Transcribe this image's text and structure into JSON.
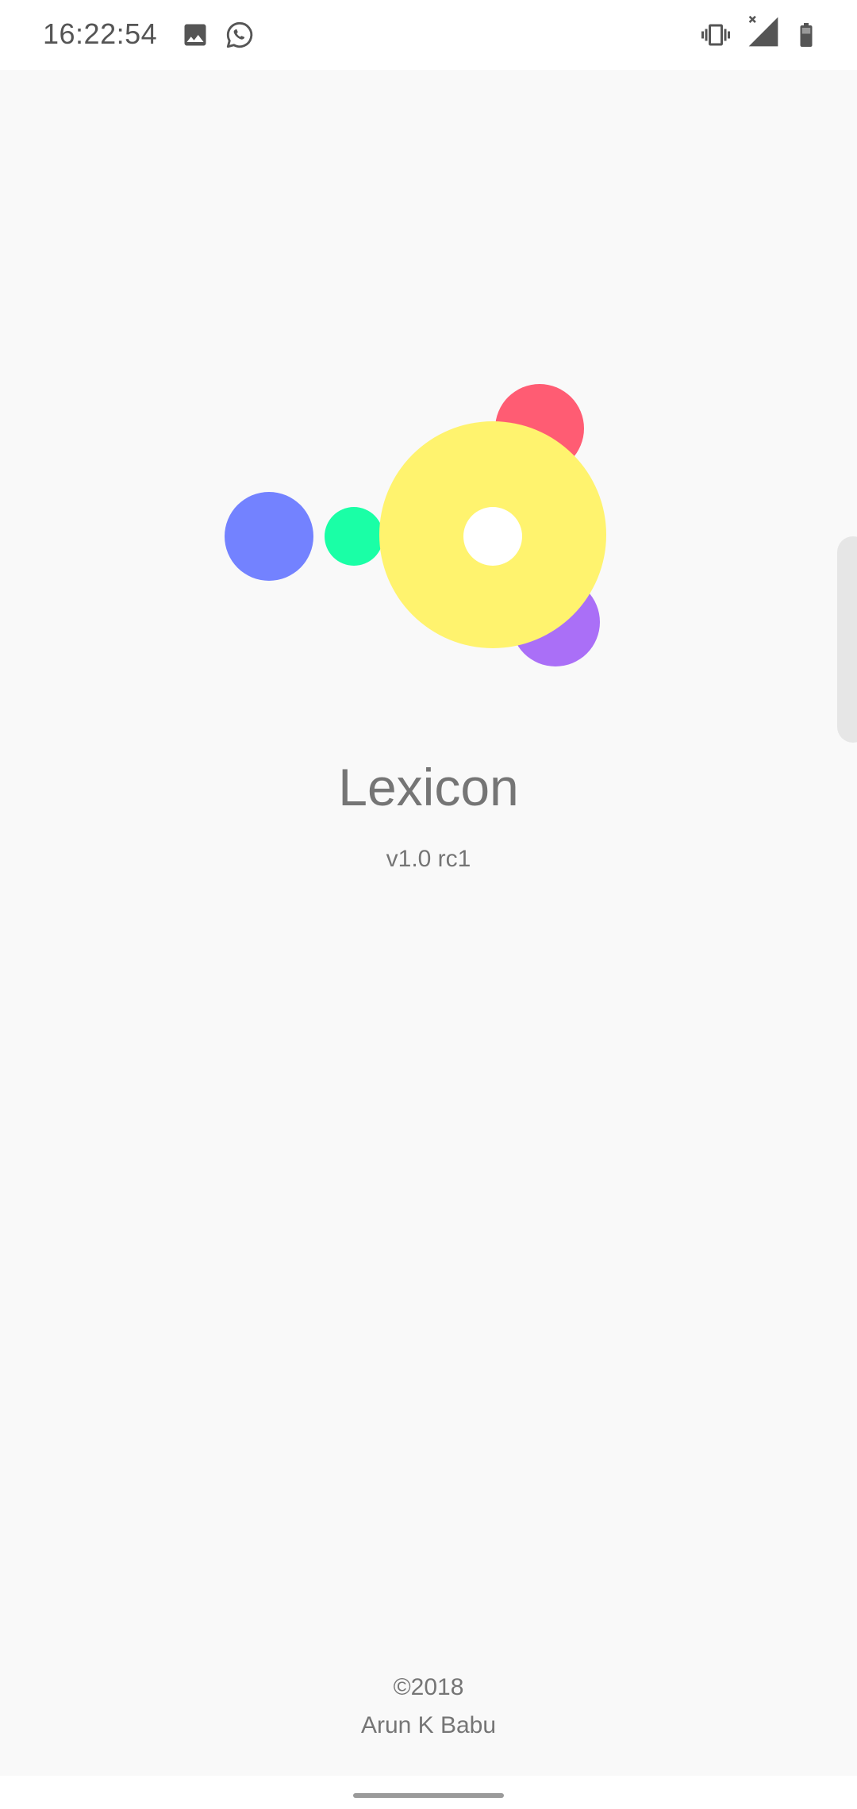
{
  "status_bar": {
    "time": "16:22:54",
    "icons_left": [
      "image-icon",
      "whatsapp-icon"
    ],
    "icons_right": [
      "vibrate-icon",
      "signal-no-service-icon",
      "battery-icon"
    ]
  },
  "app": {
    "name": "Lexicon",
    "version": "v1.0 rc1"
  },
  "footer": {
    "copyright": "©2018",
    "author": "Arun K Babu"
  },
  "colors": {
    "background": "#f9f9f9",
    "text": "#757575",
    "logo_blue": "#7382ff",
    "logo_green": "#1affa6",
    "logo_yellow": "#fff36e",
    "logo_red": "#ff5c73",
    "logo_purple": "#aa6ff7"
  }
}
